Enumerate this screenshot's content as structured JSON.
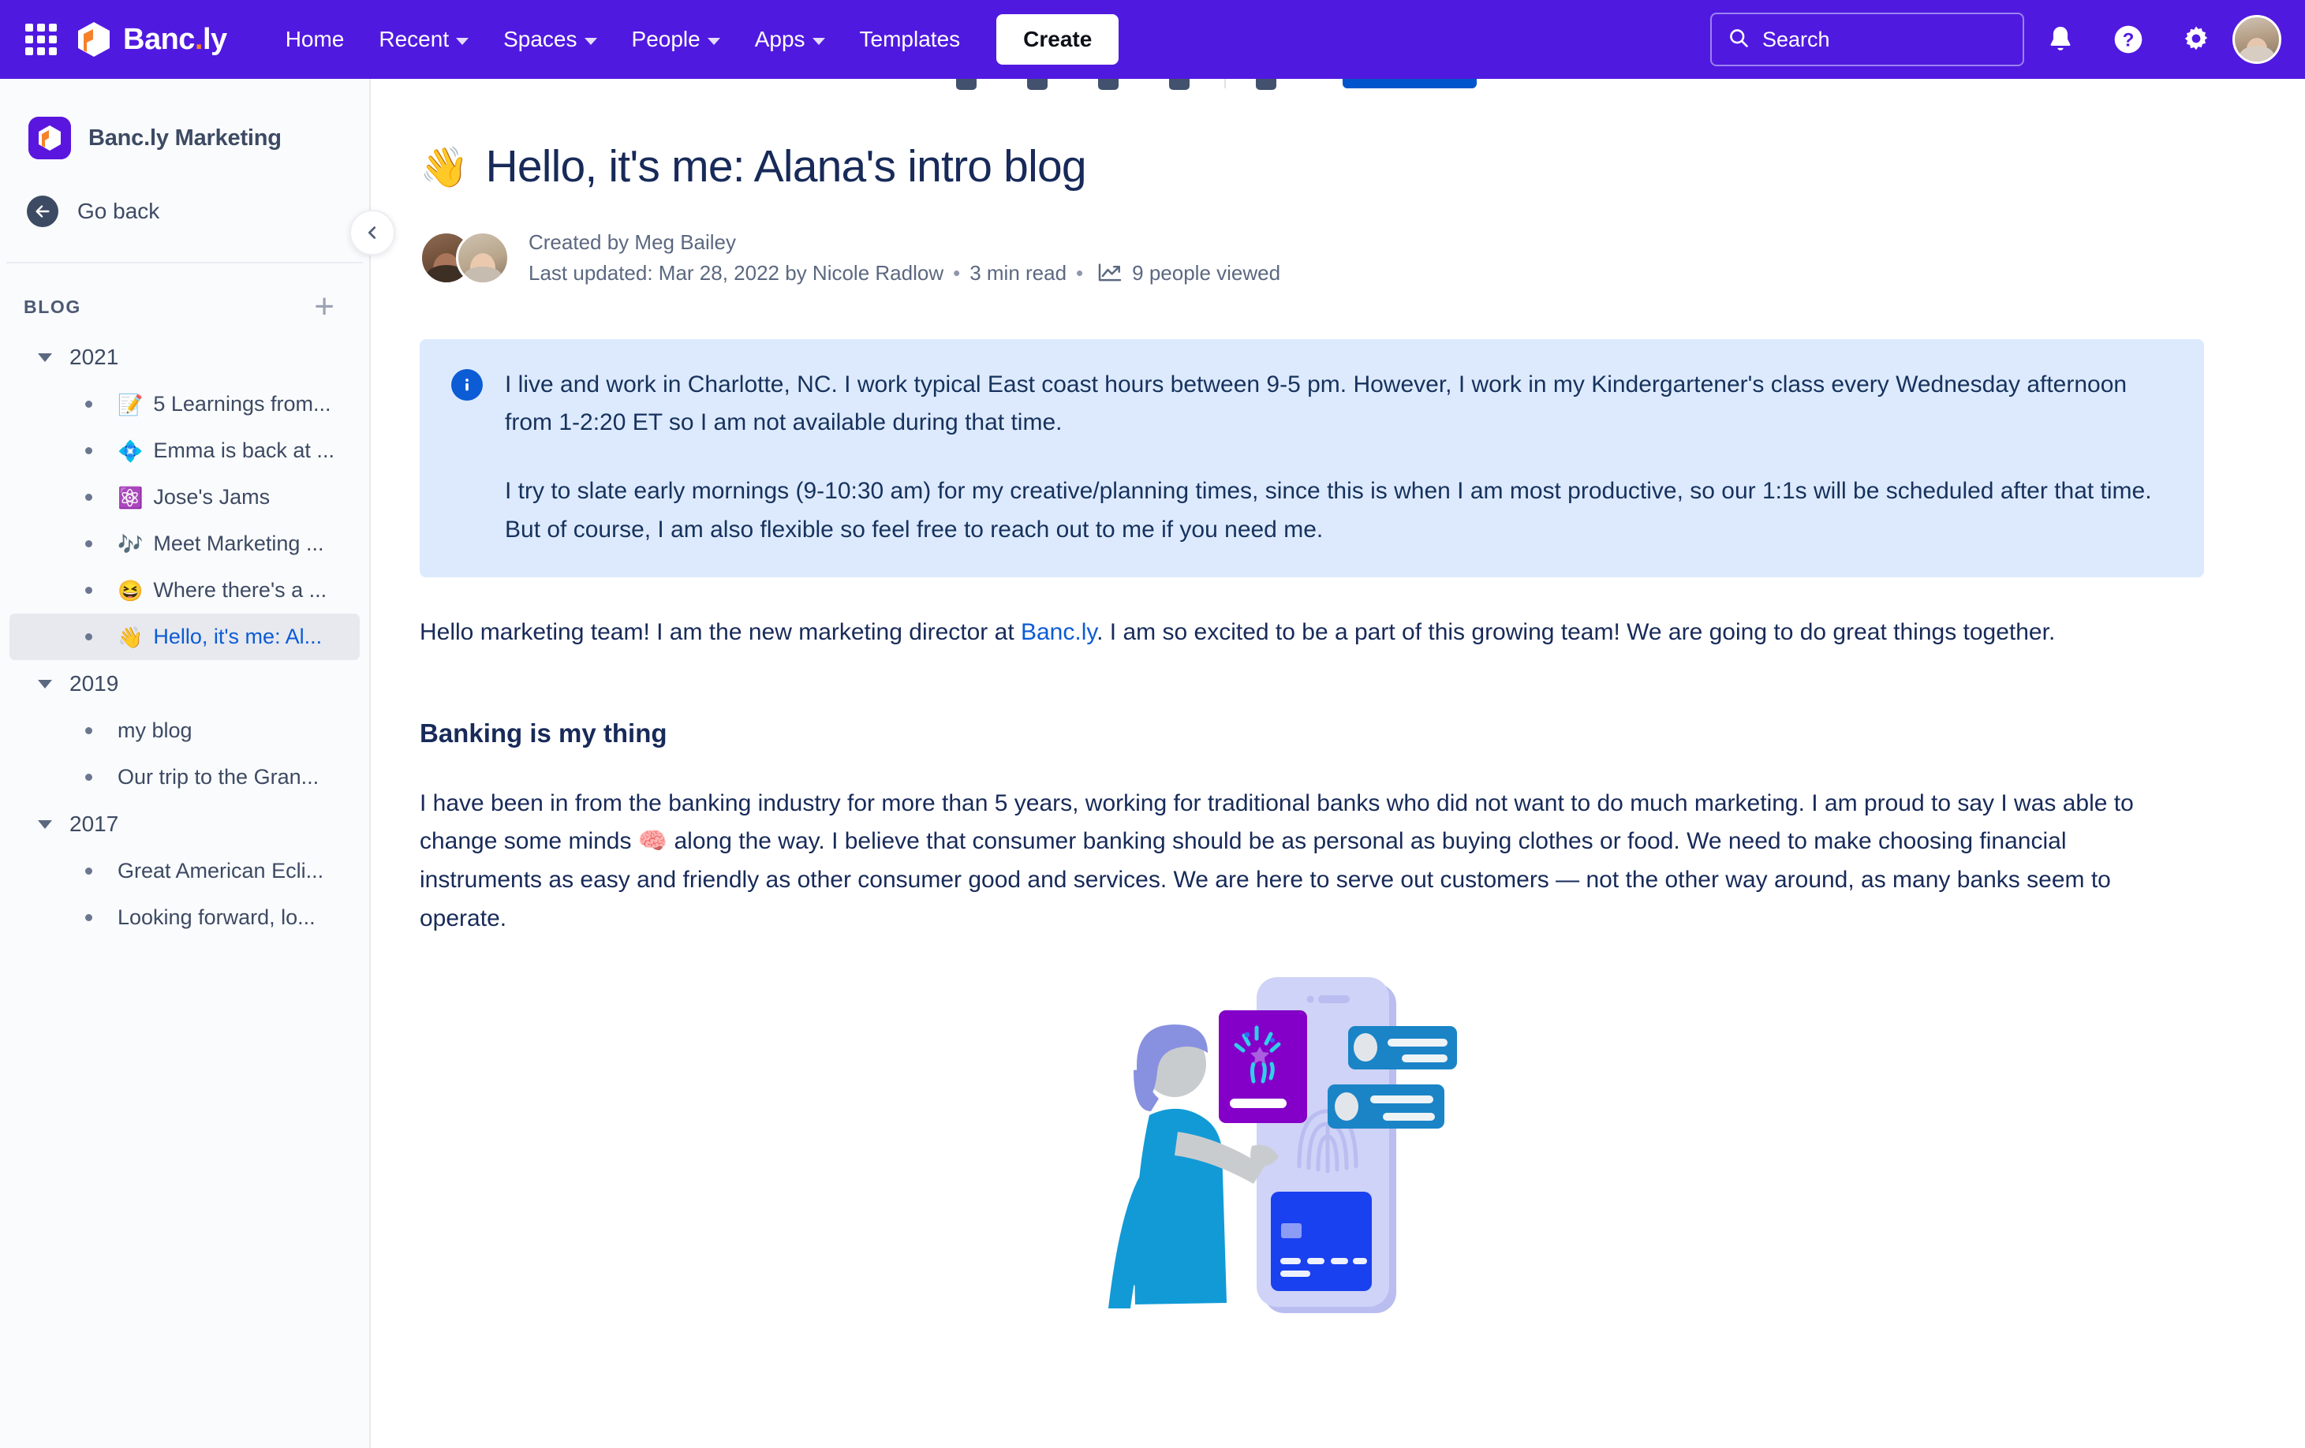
{
  "topnav": {
    "brand": {
      "name": "Banc",
      "dot": ".",
      "suffix": "ly"
    },
    "items": [
      {
        "label": "Home",
        "has_caret": false
      },
      {
        "label": "Recent",
        "has_caret": true
      },
      {
        "label": "Spaces",
        "has_caret": true
      },
      {
        "label": "People",
        "has_caret": true
      },
      {
        "label": "Apps",
        "has_caret": true
      },
      {
        "label": "Templates",
        "has_caret": false
      }
    ],
    "create_label": "Create",
    "search_placeholder": "Search",
    "search_value": "",
    "icons": [
      "apps-grid-icon",
      "search-icon",
      "notifications-bell-icon",
      "help-question-icon",
      "settings-gear-icon",
      "user-avatar"
    ],
    "accent_color": "#5019E0"
  },
  "sidebar": {
    "space_title": "Banc.ly Marketing",
    "go_back_label": "Go back",
    "section_label": "BLOG",
    "add_label": "+",
    "tree": [
      {
        "year": "2021",
        "expanded": true,
        "children": [
          {
            "emoji": "📝",
            "label": "5 Learnings from...",
            "active": false
          },
          {
            "emoji": "💠",
            "label": "Emma is back at ...",
            "active": false
          },
          {
            "emoji": "⚛️",
            "label": "Jose's Jams",
            "active": false
          },
          {
            "emoji": "🎶",
            "label": "Meet Marketing ...",
            "active": false
          },
          {
            "emoji": "😆",
            "label": "Where there's a ...",
            "active": false
          },
          {
            "emoji": "👋",
            "label": "Hello, it's me: Al...",
            "active": true
          }
        ]
      },
      {
        "year": "2019",
        "expanded": true,
        "children": [
          {
            "emoji": "",
            "label": "my blog",
            "active": false
          },
          {
            "emoji": "",
            "label": "Our trip to the Gran...",
            "active": false
          }
        ]
      },
      {
        "year": "2017",
        "expanded": true,
        "children": [
          {
            "emoji": "",
            "label": "Great American Ecli...",
            "active": false
          },
          {
            "emoji": "",
            "label": "Looking forward, lo...",
            "active": false
          }
        ]
      }
    ]
  },
  "document": {
    "title_emoji": "👋",
    "title": "Hello, it's me: Alana's intro blog",
    "created_by": "Created by Meg Bailey",
    "last_updated": "Last updated: Mar 28, 2022 by Nicole Radlow",
    "read_time": "3 min read",
    "views": "9 people viewed",
    "views_icon": "analytics-chart-icon",
    "separator": "•",
    "info_panel": {
      "icon": "info-icon",
      "paragraphs": [
        "I live and work in Charlotte, NC. I work typical East coast hours between 9-5 pm. However, I work in my Kindergartener's class every Wednesday afternoon from 1-2:20 ET so I am not available during that time.",
        "I try to slate early mornings (9-10:30 am) for my creative/planning times, since this is when I am most productive, so our 1:1s will be scheduled after that time. But of course, I am also flexible so feel free to reach out to me if you need me."
      ],
      "background": "#DDEAFE"
    },
    "intro_before_link": "Hello marketing team! I am the new marketing director at ",
    "intro_link": "Banc.ly",
    "intro_after_link": ". I am so excited to be a part of this growing team! We are going to do great things together.",
    "heading_2": "Banking is my thing",
    "body_paragraph": "I have been in from the banking industry for more than 5 years, working for traditional banks who did not want to do much marketing. I am proud to say I was able to change some minds 🧠 along the way. I believe that consumer banking should be as personal as buying clothes or food. We need to make choosing financial instruments as easy and friendly as other consumer good and services. We are here to serve out customers — not the other way around, as many banks seem to operate.",
    "illustration": "woman-with-phone-banking-illustration"
  }
}
